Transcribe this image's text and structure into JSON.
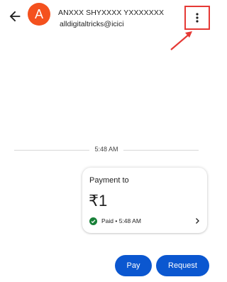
{
  "header": {
    "avatar_letter": "A",
    "name": "ANXXX SHYXXXX YXXXXXXX",
    "upi_id": "alldigitaltricks@icici"
  },
  "timeline": {
    "time": "5:48 AM"
  },
  "payment_card": {
    "title": "Payment to",
    "amount": "₹1",
    "status": "Paid • 5:48 AM"
  },
  "actions": {
    "pay_label": "Pay",
    "request_label": "Request"
  },
  "colors": {
    "avatar_bg": "#f4511e",
    "primary_button": "#0b57d0",
    "annotation_red": "#e53935",
    "paid_check": "#188038"
  },
  "icons": {
    "back": "arrow-left-icon",
    "menu": "more-vert-icon",
    "paid": "check-circle-icon",
    "chevron": "chevron-right-icon"
  }
}
